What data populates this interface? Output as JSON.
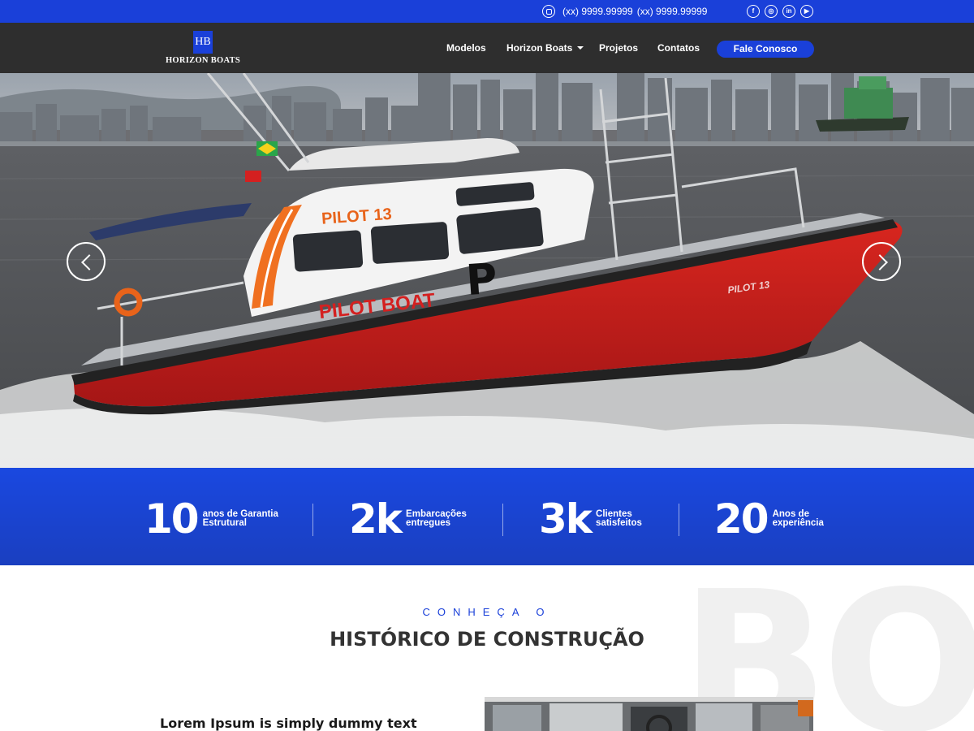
{
  "topbar": {
    "phones": [
      "(xx) 9999.99999",
      "(xx) 9999.99999"
    ],
    "whatsapp_icon": "whatsapp-icon",
    "social_icons": [
      "facebook-icon",
      "instagram-icon",
      "linkedin-icon",
      "youtube-icon"
    ],
    "social_glyphs": [
      "f",
      "◎",
      "in",
      "▶"
    ]
  },
  "brand": {
    "mark": "HB",
    "name": "HORIZON BOATS"
  },
  "nav": {
    "items": [
      "Modelos",
      "Horizon Boats",
      "Projetos",
      "Contatos"
    ],
    "cta": "Fale Conosco"
  },
  "hero": {
    "boat_name": "PILOT 13",
    "boat_label": "PILOT BOAT",
    "boat_letter": "P",
    "hull_label": "PILOT 13",
    "prev_icon": "chevron-left-icon",
    "next_icon": "chevron-right-icon"
  },
  "stats": [
    {
      "value": "10",
      "line1": "anos de Garantia",
      "line2": "Estrutural"
    },
    {
      "value": "2k",
      "line1": "Embarcações",
      "line2": "entregues"
    },
    {
      "value": "3k",
      "line1": "Clientes",
      "line2": "satisfeitos"
    },
    {
      "value": "20",
      "line1": "Anos de",
      "line2": "experiência"
    }
  ],
  "section": {
    "eyebrow": "CONHEÇA O",
    "title": "HISTÓRICO DE CONSTRUÇÃO",
    "watermark": "BO",
    "lead": "Lorem Ipsum is simply dummy text"
  },
  "colors": {
    "brand_blue": "#1a40d9",
    "navbar": "#1e1e1e",
    "hull_red": "#cc1e1e",
    "stripe_orange": "#f07020"
  }
}
